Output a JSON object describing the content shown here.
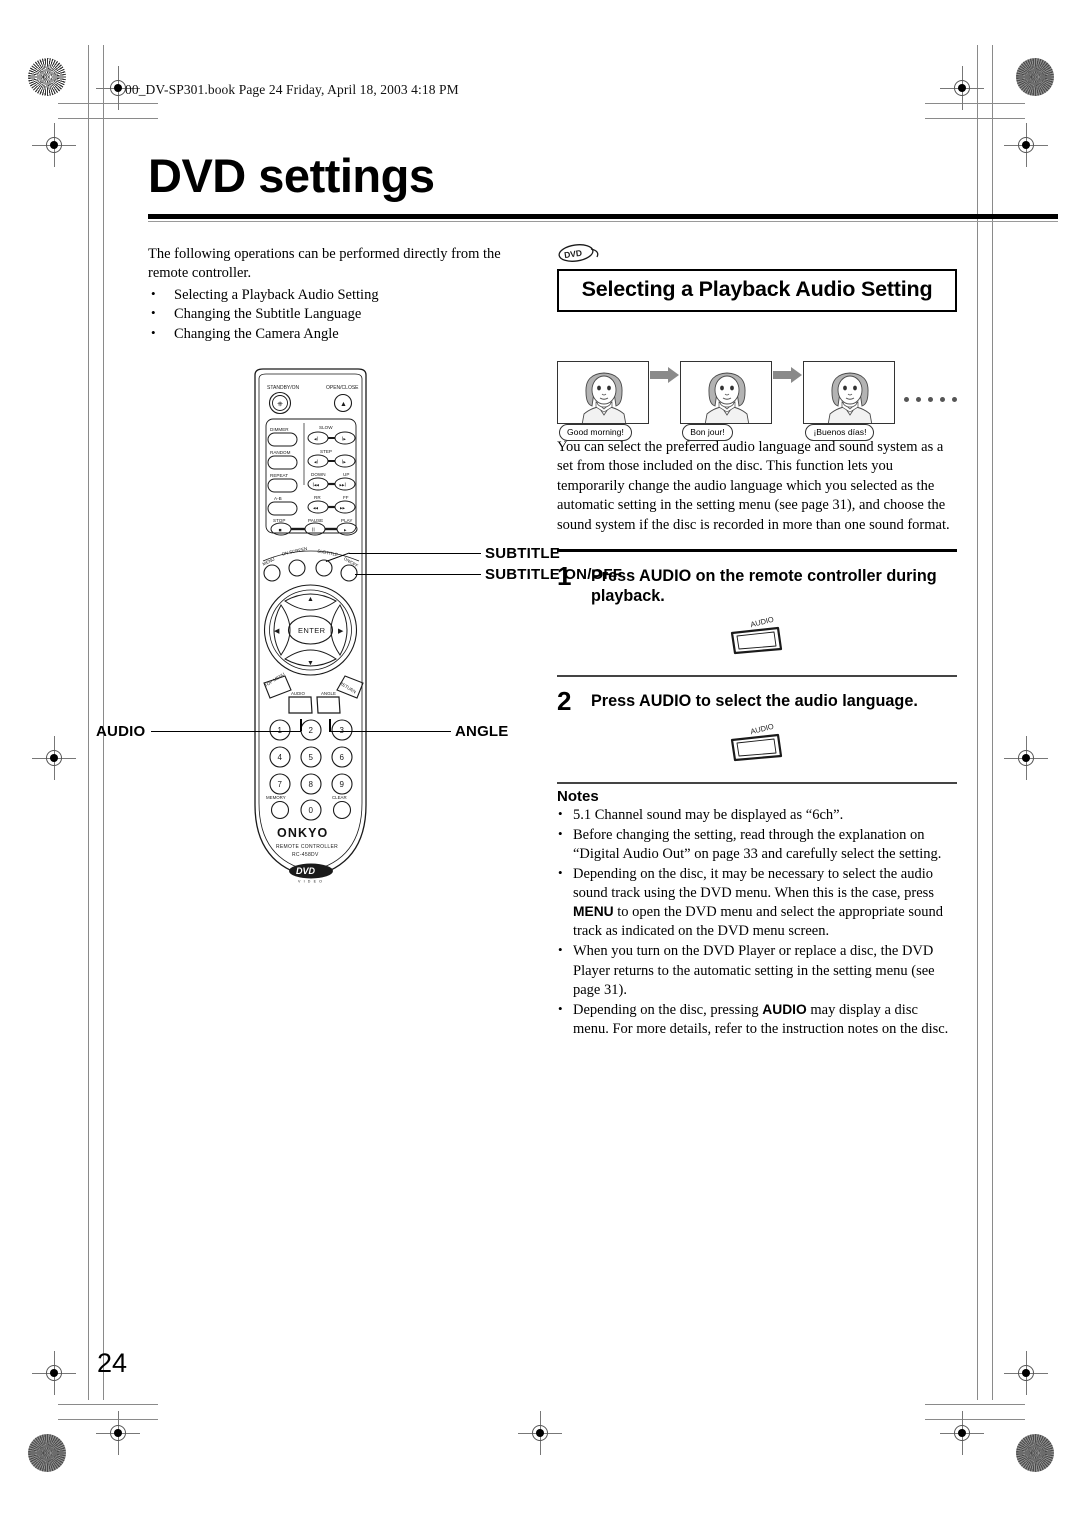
{
  "file_header": "00_DV-SP301.book  Page 24  Friday, April 18, 2003  4:18 PM",
  "page_title": "DVD settings",
  "page_number": "24",
  "left_column": {
    "intro": "The following operations can be performed directly from the remote controller.",
    "bullets": [
      "Selecting a Playback Audio Setting",
      "Changing the Subtitle Language",
      "Changing the Camera Angle"
    ],
    "remote": {
      "callouts": {
        "subtitle": "SUBTITLE",
        "subtitle_on_off": "SUBTITLE ON/OFF",
        "audio": "AUDIO",
        "angle": "ANGLE"
      },
      "buttons": {
        "standby": "STANDBY/ON",
        "open_close": "OPEN/CLOSE",
        "dimmer": "DIMMER",
        "slow": "SLOW",
        "random": "RANDOM",
        "step": "STEP",
        "repeat": "REPEAT",
        "down": "DOWN",
        "up": "UP",
        "ab": "A-B",
        "rr": "RR",
        "ff": "FF",
        "stop": "STOP",
        "pause": "PAUSE",
        "play": "PLAY",
        "menu": "MENU",
        "on_screen": "ON SCREEN",
        "subtitle": "SUBTITLE",
        "subtitle_on_off": "ON/OFF",
        "enter": "ENTER",
        "top_menu": "TOP MENU",
        "audio": "AUDIO",
        "angle": "ANGLE",
        "return": "RETURN",
        "memory": "MEMORY",
        "clear": "CLEAR"
      },
      "keypad": [
        "1",
        "2",
        "3",
        "4",
        "5",
        "6",
        "7",
        "8",
        "9",
        "0"
      ],
      "brand": "ONKYO",
      "model_line1": "REMOTE CONTROLLER",
      "model_line2": "RC-458DV",
      "disc_logo": "DVD",
      "disc_logo_sub": "V I D E O"
    }
  },
  "right_column": {
    "badge": "DVD",
    "section_title": "Selecting a Playback Audio Setting",
    "illustration": {
      "panels": [
        {
          "bubble": "Good morning!"
        },
        {
          "bubble": "Bon jour!"
        },
        {
          "bubble": "¡Buenos días!"
        }
      ],
      "trailing_dots": 5
    },
    "body": "You can select the preferred audio language and sound system as a set from those included on the disc. This function lets you temporarily change the audio language which you selected as the automatic setting in the setting menu (see page 31), and choose the sound system if the disc is recorded in more than one sound format.",
    "steps": [
      {
        "num": "1",
        "text": "Press AUDIO on the remote controller during playback.",
        "key_label": "AUDIO"
      },
      {
        "num": "2",
        "text": "Press AUDIO to select the audio language.",
        "key_label": "AUDIO"
      }
    ],
    "notes_heading": "Notes",
    "notes": [
      "5.1 Channel sound may be displayed as “6ch”.",
      "Before changing the setting, read through the explanation on “Digital Audio Out” on page 33 and carefully select the setting.",
      "Depending on the disc, it may be necessary to select the audio sound track using the DVD menu. When this is the case, press MENU to open the DVD menu and select the appropriate sound track as indicated on the DVD menu screen.",
      "When you turn on the DVD Player or replace a disc, the DVD Player returns to the automatic setting in the setting menu (see page 31).",
      "Depending on the disc, pressing AUDIO may display a disc menu. For more details, refer to the instruction notes on the disc."
    ]
  }
}
